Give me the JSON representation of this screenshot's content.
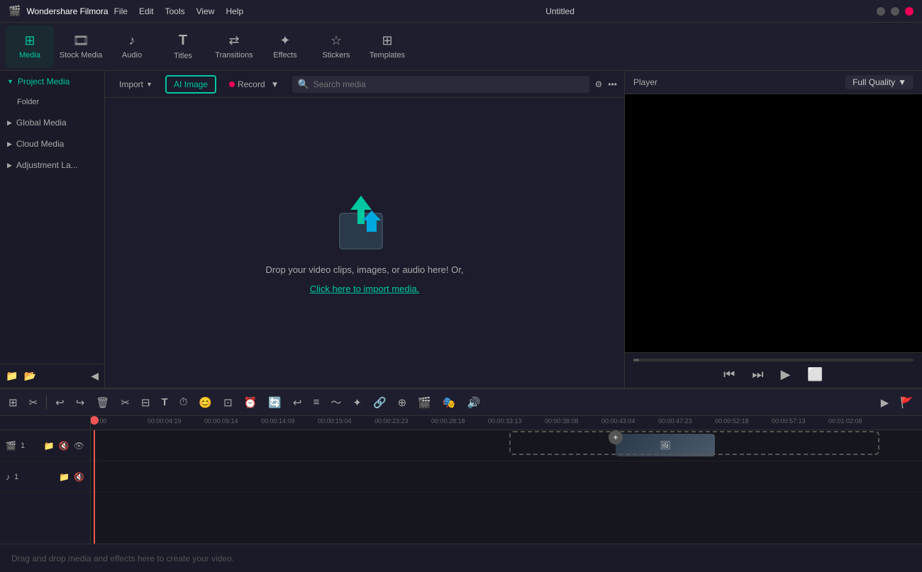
{
  "app": {
    "name": "Wondershare Filmora",
    "logo": "🎬",
    "title": "Untitled",
    "menu_items": [
      "File",
      "Edit",
      "Tools",
      "View",
      "Help"
    ]
  },
  "toolbar": {
    "items": [
      {
        "id": "media",
        "label": "Media",
        "icon": "▦",
        "active": true
      },
      {
        "id": "stock_media",
        "label": "Stock Media",
        "icon": "🎞"
      },
      {
        "id": "audio",
        "label": "Audio",
        "icon": "♪"
      },
      {
        "id": "titles",
        "label": "Titles",
        "icon": "T"
      },
      {
        "id": "transitions",
        "label": "Transitions",
        "icon": "⇄"
      },
      {
        "id": "effects",
        "label": "Effects",
        "icon": "✦"
      },
      {
        "id": "stickers",
        "label": "Stickers",
        "icon": "☆"
      },
      {
        "id": "templates",
        "label": "Templates",
        "icon": "⊞"
      }
    ]
  },
  "sidebar": {
    "items": [
      {
        "id": "project_media",
        "label": "Project Media",
        "active": true,
        "arrow": "▼"
      },
      {
        "id": "folder",
        "label": "Folder",
        "sub": true
      },
      {
        "id": "global_media",
        "label": "Global Media",
        "active": false,
        "arrow": "▶"
      },
      {
        "id": "cloud_media",
        "label": "Cloud Media",
        "active": false,
        "arrow": "▶"
      },
      {
        "id": "adjustment_la",
        "label": "Adjustment La...",
        "active": false,
        "arrow": "▶"
      }
    ],
    "bottom_icons": [
      "📁",
      "📂"
    ]
  },
  "media_panel": {
    "import_label": "Import",
    "ai_image_label": "AI Image",
    "record_label": "Record",
    "search_placeholder": "Search media",
    "drop_text": "Drop your video clips, images, or audio here! Or,",
    "drop_link": "Click here to import media."
  },
  "player": {
    "label": "Player",
    "quality_label": "Full Quality",
    "controls": [
      "⏮",
      "⏭",
      "▶",
      "⬜"
    ]
  },
  "timeline": {
    "ruler_marks": [
      "00:00",
      "00:00:04:19",
      "00:00:09:14",
      "00:00:14:09",
      "00:00:19:04",
      "00:00:23:23",
      "00:00:28:18",
      "00:00:33:13",
      "00:00:38:08",
      "00:00:43:04",
      "00:00:47:23",
      "00:00:52:18",
      "00:00:57:13",
      "00:01:02:08"
    ],
    "tracks": [
      {
        "id": "video1",
        "label": "1",
        "type": "video",
        "icons": [
          "📽",
          "📁",
          "🔇",
          "👁"
        ]
      },
      {
        "id": "audio1",
        "label": "1",
        "type": "audio",
        "icons": [
          "📁",
          "🔇"
        ]
      }
    ],
    "bottom_hint": "Drag and drop media and effects here to create your video.",
    "toolbar_icons": [
      "⊞",
      "✂",
      "|",
      "↩",
      "↪",
      "🗑",
      "✂",
      "⊟",
      "T",
      "⏱",
      "😊",
      "⊡",
      "⏰",
      "🔄",
      "↩",
      "≡",
      "〜",
      "✦",
      "🔗",
      "⊕",
      "🎬",
      "🎭",
      "🔊",
      "⊕"
    ]
  }
}
